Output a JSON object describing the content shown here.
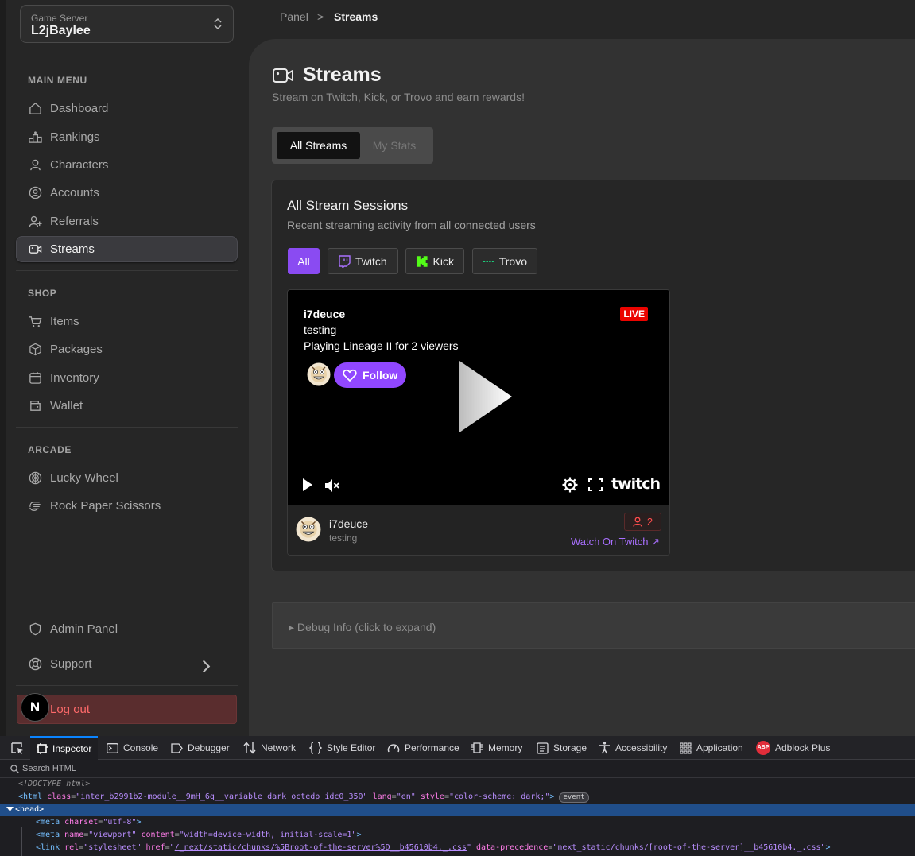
{
  "sidebar": {
    "server_label": "Game Server",
    "server_name": "L2jBaylee",
    "sections": {
      "main": "MAIN MENU",
      "shop": "SHOP",
      "arcade": "ARCADE"
    },
    "items": {
      "dashboard": "Dashboard",
      "rankings": "Rankings",
      "characters": "Characters",
      "accounts": "Accounts",
      "referrals": "Referrals",
      "streams": "Streams",
      "items": "Items",
      "packages": "Packages",
      "inventory": "Inventory",
      "wallet": "Wallet",
      "lucky_wheel": "Lucky Wheel",
      "rps": "Rock Paper Scissors",
      "admin": "Admin Panel",
      "support": "Support"
    },
    "logout": "Log out",
    "logo_letter": "N"
  },
  "breadcrumb": {
    "parent": "Panel",
    "separator": ">",
    "current": "Streams"
  },
  "page": {
    "title": "Streams",
    "subtitle": "Stream on Twitch, Kick, or Trovo and earn rewards!",
    "tabs": {
      "all": "All Streams",
      "stats": "My Stats"
    }
  },
  "sessions": {
    "title": "All Stream Sessions",
    "subtitle": "Recent streaming activity from all connected users",
    "filters": {
      "all": "All",
      "twitch": "Twitch",
      "kick": "Kick",
      "trovo": "Trovo"
    }
  },
  "stream": {
    "username": "i7deuce",
    "title": "testing",
    "playing": "Playing Lineage II for 2 viewers",
    "live_badge": "LIVE",
    "follow_label": "Follow",
    "platform_brand": "twitch",
    "viewer_count": "2",
    "watch_link": "Watch On Twitch ↗"
  },
  "debug": {
    "label": "▸ Debug Info (click to expand)"
  },
  "devtools": {
    "tabs": {
      "inspector": "Inspector",
      "console": "Console",
      "debugger": "Debugger",
      "network": "Network",
      "style_editor": "Style Editor",
      "performance": "Performance",
      "memory": "Memory",
      "storage": "Storage",
      "accessibility": "Accessibility",
      "application": "Application",
      "adblock": "Adblock Plus",
      "adblock_icon": "ABP"
    },
    "search_placeholder": "Search HTML",
    "lines": {
      "doctype": "<!DOCTYPE html>",
      "html_open": "<html",
      "html_class_attr": "class",
      "html_class_val": "\"inter_b2991b2-module__9mH_6q__variable dark octedp idc0_350\"",
      "html_lang_attr": "lang",
      "html_lang_val": "\"en\"",
      "html_style_attr": "style",
      "html_style_val": "\"color-scheme: dark;\"",
      "html_close": ">",
      "event_badge": "event",
      "head": "<head>",
      "meta_charset_tag": "<meta",
      "meta_charset_attr": "charset",
      "meta_charset_val": "\"utf-8\"",
      "meta_vp_tag": "<meta",
      "meta_vp_name_attr": "name",
      "meta_vp_name_val": "\"viewport\"",
      "meta_vp_content_attr": "content",
      "meta_vp_content_val": "\"width=device-width, initial-scale=1\"",
      "link_tag": "<link",
      "link_rel_attr": "rel",
      "link_rel_val": "\"stylesheet\"",
      "link_href_attr": "href",
      "link_href_val": "/_next/static/chunks/%5Broot-of-the-server%5D__b45610b4._.css",
      "link_prec_attr": "data-precedence",
      "link_prec_val": "\"next_static/chunks/[root-of-the-server]__b45610b4._.css\""
    }
  },
  "colors": {
    "accent_purple": "#8a4bf2",
    "twitch_purple": "#9147ff",
    "live_red": "#eb0400",
    "logout_bg": "#5a2d2e",
    "kick_green": "#53fc18",
    "trovo_green": "#1bcc7a"
  },
  "icons": {
    "dashboard": "home-icon",
    "rankings": "podium-icon",
    "characters": "user-icon",
    "accounts": "user-circle-icon",
    "referrals": "user-plus-icon",
    "streams": "video-icon",
    "items": "cart-icon",
    "packages": "box-icon",
    "inventory": "calendar-icon",
    "wallet": "wallet-icon",
    "lucky_wheel": "wheel-icon",
    "rps": "hand-icon",
    "admin": "shield-icon",
    "support": "lifebuoy-icon"
  }
}
